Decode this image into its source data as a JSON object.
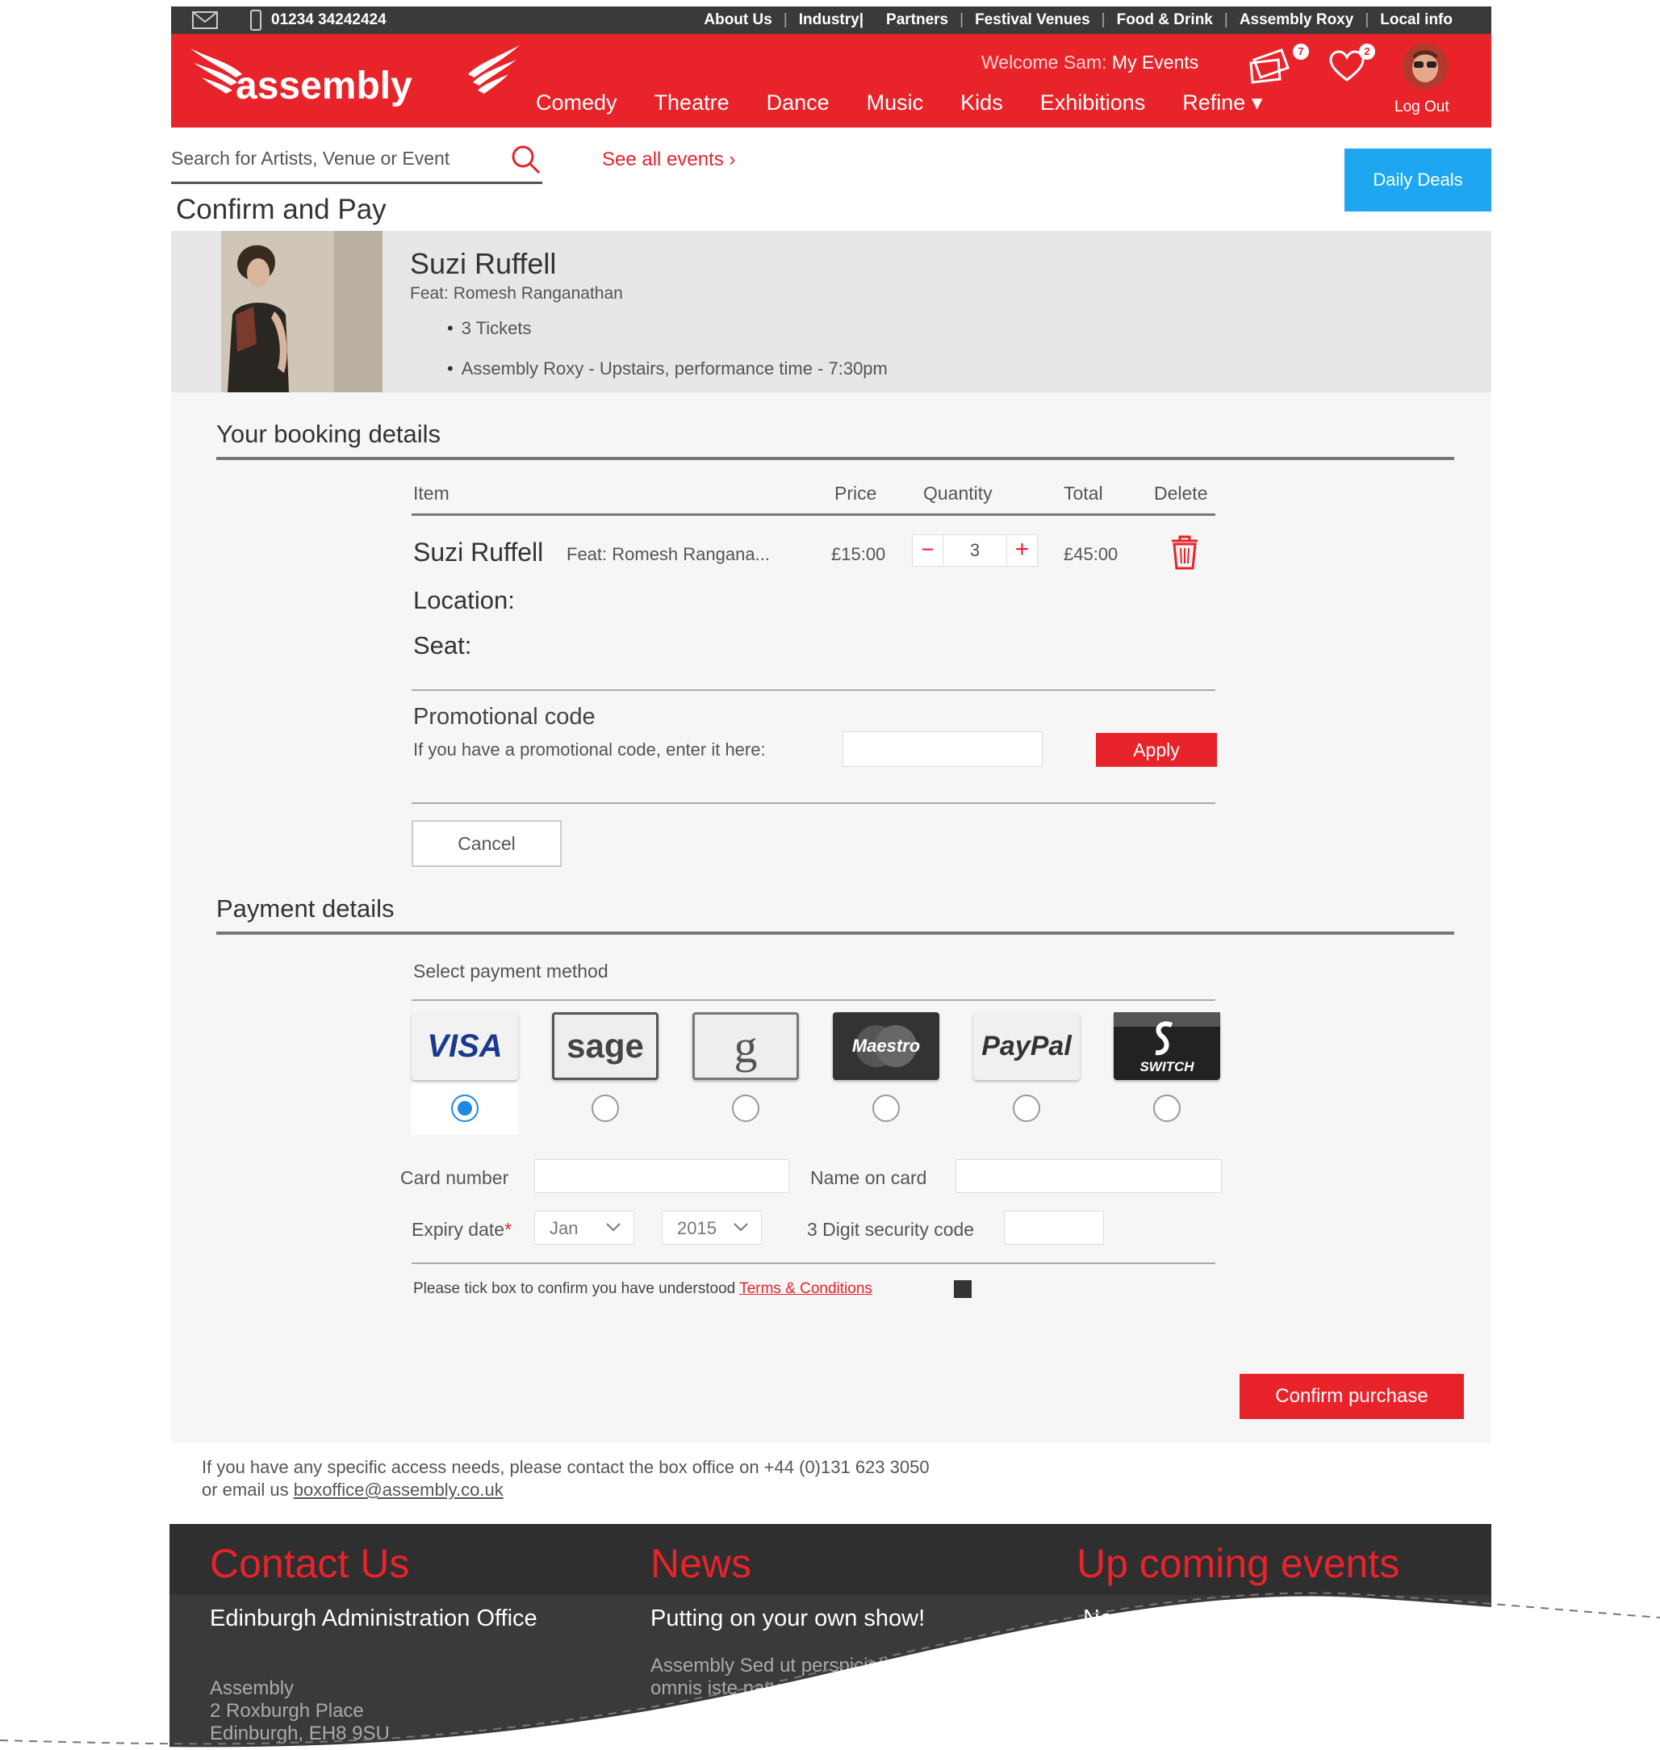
{
  "topbar": {
    "phone": "01234 34242424",
    "links": [
      "About Us",
      "Industry|",
      "Partners",
      "Festival Venues",
      "Food & Drink",
      "Assembly Roxy",
      "Local info"
    ]
  },
  "header": {
    "logo_text": "assembly",
    "welcome_prefix": "Welcome Sam:",
    "my_events": "My Events",
    "nav": [
      "Comedy",
      "Theatre",
      "Dance",
      "Music",
      "Kids",
      "Exhibitions",
      "Refine ▾"
    ],
    "tickets_badge": "7",
    "likes_badge": "2",
    "logout": "Log Out",
    "accent": "#e8232a"
  },
  "search": {
    "placeholder": "Search for Artists, Venue or Event",
    "see_all": "See all events  ›",
    "daily_deals": "Daily Deals"
  },
  "page_title": "Confirm and Pay",
  "event": {
    "name": "Suzi Ruffell",
    "feat": "Feat: Romesh Ranganathan",
    "bullets": [
      "3 Tickets",
      "Assembly Roxy - Upstairs, performance time - 7:30pm"
    ]
  },
  "booking": {
    "heading": "Your booking details",
    "columns": [
      "Item",
      "Price",
      "Quantity",
      "Total",
      "Delete"
    ],
    "row": {
      "name": "Suzi Ruffell",
      "feat": "Feat:  Romesh Rangana...",
      "price": "£15:00",
      "quantity": "3",
      "total": "£45:00"
    },
    "location_label": "Location:",
    "seat_label": "Seat:",
    "promo_title": "Promotional code",
    "promo_label": "If you have a promotional code, enter it here:",
    "apply": "Apply",
    "cancel": "Cancel"
  },
  "payment": {
    "heading": "Payment details",
    "select_label": "Select payment method",
    "methods": [
      "VISA",
      "sage",
      "g",
      "Maestro",
      "PayPal",
      "SWITCH"
    ],
    "selected": "VISA",
    "card_number_label": "Card number",
    "name_on_card_label": "Name on card",
    "expiry_label": "Expiry date",
    "expiry_month": "Jan",
    "expiry_year": "2015",
    "security_label": "3 Digit security code",
    "terms_prefix": "Please tick box to confirm you have understood",
    "terms_link": "Terms & Conditions",
    "confirm": "Confirm purchase"
  },
  "access": {
    "line1": "If you have any specific access needs, please contact the box office on +44 (0)131 623 3050",
    "line2_prefix": "or email us",
    "email": "boxoffice@assembly.co.uk"
  },
  "footer": {
    "contact_heading": "Contact Us",
    "contact_sub": "Edinburgh Administration Office",
    "contact_lines": [
      "Assembly",
      "2 Roxburgh Place",
      "Edinburgh, EH8 9SU"
    ],
    "news_heading": "News",
    "news_sub": "Putting on your own show!",
    "news_body": [
      "Assembly Sed ut perspiciatis",
      "omnis iste natus"
    ],
    "events_heading": "Up coming events",
    "events_sub": "Normal Madness"
  }
}
